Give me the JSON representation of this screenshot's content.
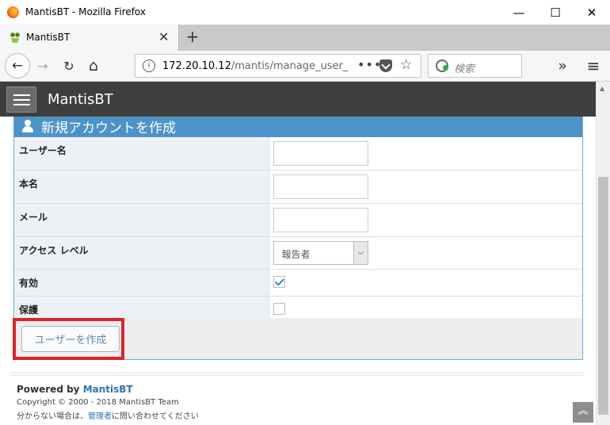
{
  "window": {
    "title": "MantisBT - Mozilla Firefox",
    "minimize": "—",
    "maximize": "☐",
    "close": "✕"
  },
  "tab": {
    "label": "MantisBT",
    "close": "✕",
    "new_tab": "+"
  },
  "nav": {
    "back": "←",
    "forward": "→",
    "reload": "↻",
    "home": "⌂",
    "info": "i",
    "url_host": "172.20.10.12",
    "url_path": "/mantis/manage_user_",
    "page_actions": "•••",
    "bookmark": "☆",
    "search_placeholder": "検索",
    "overflow": "»",
    "menu": "≡"
  },
  "app": {
    "brand": "MantisBT"
  },
  "form": {
    "title": "新規アカウントを作成",
    "fields": [
      {
        "label": "ユーザー名"
      },
      {
        "label": "本名"
      },
      {
        "label": "メール"
      },
      {
        "label": "アクセス レベル",
        "value": "報告者"
      },
      {
        "label": "有効",
        "checked": true
      },
      {
        "label": "保護",
        "checked": false
      }
    ],
    "submit_label": "ユーザーを作成"
  },
  "footer": {
    "powered_prefix": "Powered by ",
    "powered_link": "MantisBT",
    "copyright": "Copyright © 2000 - 2018 MantisBT Team",
    "contact_prefix": "分からない場合は、",
    "contact_link": "管理者",
    "contact_suffix": "に問い合わせてください"
  },
  "scroll": {
    "up_arrow": "▲",
    "to_top": "︽"
  }
}
